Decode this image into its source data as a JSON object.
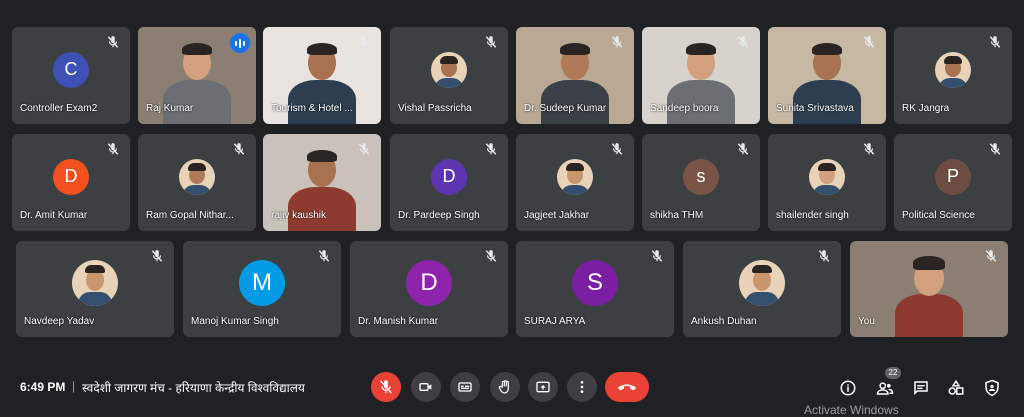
{
  "colors": {
    "background": "#202124",
    "tile": "#3c4043",
    "speaking_outline": "#8ab4f8",
    "end_call": "#ea4335"
  },
  "participants_row1": [
    {
      "name": "Controller Exam2",
      "type": "avatar",
      "initial": "C",
      "color": "#3f51b5",
      "muted": true
    },
    {
      "name": "Raj Kumar",
      "type": "video",
      "speaking": true,
      "muted": false
    },
    {
      "name": "Tourism & Hotel ...",
      "type": "video",
      "muted": true
    },
    {
      "name": "Vishal Passricha",
      "type": "photo",
      "muted": true
    },
    {
      "name": "Dr. Sudeep Kumar",
      "type": "video",
      "muted": true
    },
    {
      "name": "Sandeep boora",
      "type": "video",
      "muted": true
    },
    {
      "name": "Sunita Srivastava",
      "type": "video",
      "muted": true
    },
    {
      "name": "RK Jangra",
      "type": "photo",
      "muted": true
    }
  ],
  "participants_row2": [
    {
      "name": "Dr. Amit Kumar",
      "type": "avatar",
      "initial": "D",
      "color": "#f4511e",
      "muted": true
    },
    {
      "name": "Ram Gopal Nithar...",
      "type": "photo",
      "muted": true
    },
    {
      "name": "rajiv kaushik",
      "type": "video",
      "muted": true
    },
    {
      "name": "Dr. Pardeep Singh",
      "type": "avatar",
      "initial": "D",
      "color": "#5e35b1",
      "muted": true
    },
    {
      "name": "Jagjeet Jakhar",
      "type": "photo",
      "muted": true
    },
    {
      "name": "shikha THM",
      "type": "avatar",
      "initial": "s",
      "color": "#795548",
      "muted": true
    },
    {
      "name": "shailender singh",
      "type": "photo",
      "muted": true
    },
    {
      "name": "Political Science",
      "type": "avatar",
      "initial": "P",
      "color": "#6d4c41",
      "muted": true
    }
  ],
  "participants_row3": [
    {
      "name": "Navdeep Yadav",
      "type": "photo",
      "muted": true
    },
    {
      "name": "Manoj Kumar Singh",
      "type": "avatar",
      "initial": "M",
      "color": "#039be5",
      "muted": true
    },
    {
      "name": "Dr. Manish Kumar",
      "type": "avatar",
      "initial": "D",
      "color": "#8e24aa",
      "muted": true
    },
    {
      "name": "SURAJ ARYA",
      "type": "avatar",
      "initial": "S",
      "color": "#7b1fa2",
      "muted": true
    },
    {
      "name": "Ankush Duhan",
      "type": "photo",
      "muted": true
    },
    {
      "name": "You",
      "type": "video",
      "muted": true
    }
  ],
  "footer": {
    "time": "6:49 PM",
    "separator": "|",
    "meeting_title": "स्वदेशी जागरण मंच - हरियाणा केन्द्रीय विश्वविद्यालय",
    "participant_count": "22",
    "watermark": "Activate Windows"
  },
  "controls": [
    "mic-off-icon",
    "camera-icon",
    "captions-icon",
    "raise-hand-icon",
    "present-icon",
    "more-options-icon",
    "end-call-icon"
  ],
  "right_icons": [
    "info-icon",
    "people-icon",
    "chat-icon",
    "activities-icon",
    "host-controls-icon"
  ]
}
